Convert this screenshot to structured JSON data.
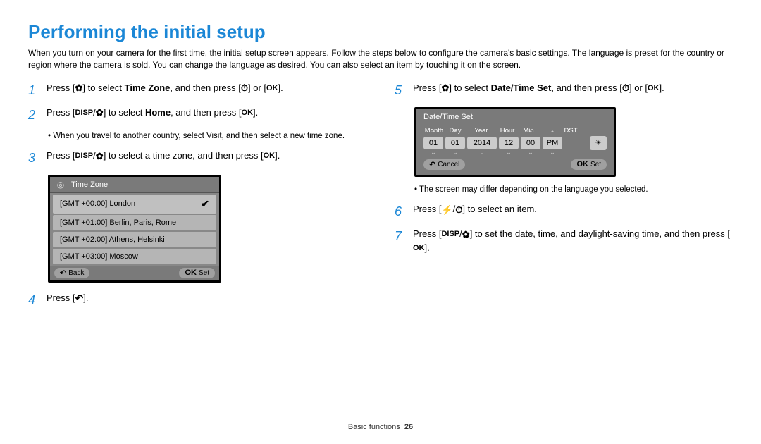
{
  "title": "Performing the initial setup",
  "intro": "When you turn on your camera for the first time, the initial setup screen appears. Follow the steps below to configure the camera's basic settings. The language is preset for the country or region where the camera is sold. You can change the language as desired. You can also select an item by touching it on the screen.",
  "steps": {
    "s1a": "Press [",
    "s1b": "] to select ",
    "s1c": "Time Zone",
    "s1d": ", and then press [",
    "s1e": "] or [",
    "s1f": "].",
    "s2a": "Press [",
    "s2b": "/",
    "s2c": "] to select ",
    "s2d": "Home",
    "s2e": ", and then press [",
    "s2f": "].",
    "s2note": "When you travel to another country, select Visit, and then select a new time zone.",
    "s3a": "Press [",
    "s3b": "/",
    "s3c": "] to select a time zone, and then press [",
    "s3d": "].",
    "s4a": "Press [",
    "s4b": "].",
    "s5a": "Press [",
    "s5b": "] to select ",
    "s5c": "Date/Time Set",
    "s5d": ", and then press [",
    "s5e": "] or [",
    "s5f": "].",
    "s5note": "The screen may differ depending on the language you selected.",
    "s6a": "Press [",
    "s6b": "/",
    "s6c": "] to select an item.",
    "s7a": "Press [",
    "s7b": "/",
    "s7c": "] to set the date, time, and daylight-saving time, and then press [",
    "s7d": "]."
  },
  "timezone": {
    "title": "Time Zone",
    "items": [
      "[GMT +00:00] London",
      "[GMT +01:00] Berlin, Paris, Rome",
      "[GMT +02:00] Athens, Helsinki",
      "[GMT +03:00] Moscow"
    ],
    "back": "Back",
    "set": "Set"
  },
  "datetime": {
    "title": "Date/Time Set",
    "labels": {
      "month": "Month",
      "day": "Day",
      "year": "Year",
      "hour": "Hour",
      "min": "Min",
      "dst": "DST"
    },
    "values": {
      "month": "01",
      "day": "01",
      "year": "2014",
      "hour": "12",
      "min": "00",
      "ampm": "PM"
    },
    "cancel": "Cancel",
    "set": "Set"
  },
  "footer": {
    "section": "Basic functions",
    "page": "26"
  }
}
